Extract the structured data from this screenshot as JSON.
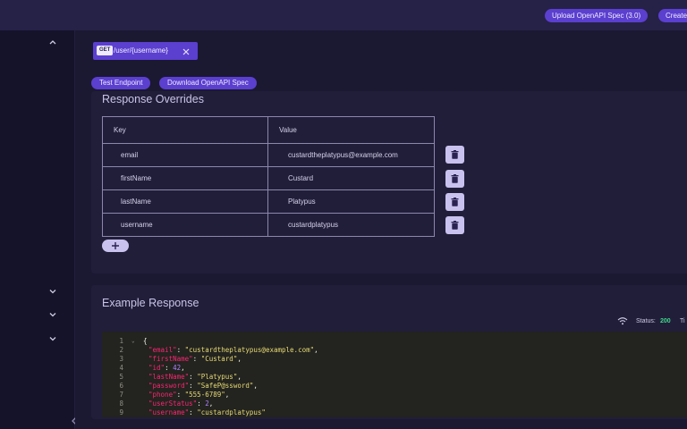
{
  "topbar": {
    "upload_label": "Upload OpenAPI Spec (3.0)",
    "create_label": "Create"
  },
  "endpoint_tab": {
    "method": "GET",
    "path": "/user/{username}"
  },
  "actions": {
    "test_label": "Test Endpoint",
    "download_label": "Download OpenAPI Spec"
  },
  "overrides": {
    "title": "Response Overrides",
    "headers": {
      "key": "Key",
      "value": "Value"
    },
    "rows": [
      {
        "key": "email",
        "value": "custardtheplatypus@example.com"
      },
      {
        "key": "firstName",
        "value": "Custard"
      },
      {
        "key": "lastName",
        "value": "Platypus"
      },
      {
        "key": "username",
        "value": "custardplatypus"
      }
    ],
    "delete_icon": "trash-icon",
    "add_icon": "plus-icon"
  },
  "example": {
    "title": "Example Response",
    "status_label": "Status:",
    "status_code": "200",
    "truncated_label": "Ti",
    "lines": [
      {
        "n": "1",
        "fold": true,
        "key": "",
        "value": "{",
        "value_type": "brace"
      },
      {
        "n": "2",
        "fold": false,
        "key": "\"email\"",
        "value": "\"custardtheplatypus@example.com\"",
        "value_type": "str"
      },
      {
        "n": "3",
        "fold": false,
        "key": "\"firstName\"",
        "value": "\"Custard\"",
        "value_type": "str"
      },
      {
        "n": "4",
        "fold": false,
        "key": "\"id\"",
        "value": "42",
        "value_type": "num"
      },
      {
        "n": "5",
        "fold": false,
        "key": "\"lastName\"",
        "value": "\"Platypus\"",
        "value_type": "str"
      },
      {
        "n": "6",
        "fold": false,
        "key": "\"password\"",
        "value": "\"SafeP@ssword\"",
        "value_type": "str"
      },
      {
        "n": "7",
        "fold": false,
        "key": "\"phone\"",
        "value": "\"555-6789\"",
        "value_type": "str"
      },
      {
        "n": "8",
        "fold": false,
        "key": "\"userStatus\"",
        "value": "2",
        "value_type": "num"
      },
      {
        "n": "9",
        "fold": false,
        "key": "\"username\"",
        "value": "\"custardplatypus\"",
        "value_type": "str"
      }
    ]
  },
  "colors": {
    "accent": "#5b3fcf",
    "status_ok": "#3fd88a",
    "json_key": "#f92672",
    "json_string": "#e6db74",
    "json_number": "#ae81ff"
  }
}
